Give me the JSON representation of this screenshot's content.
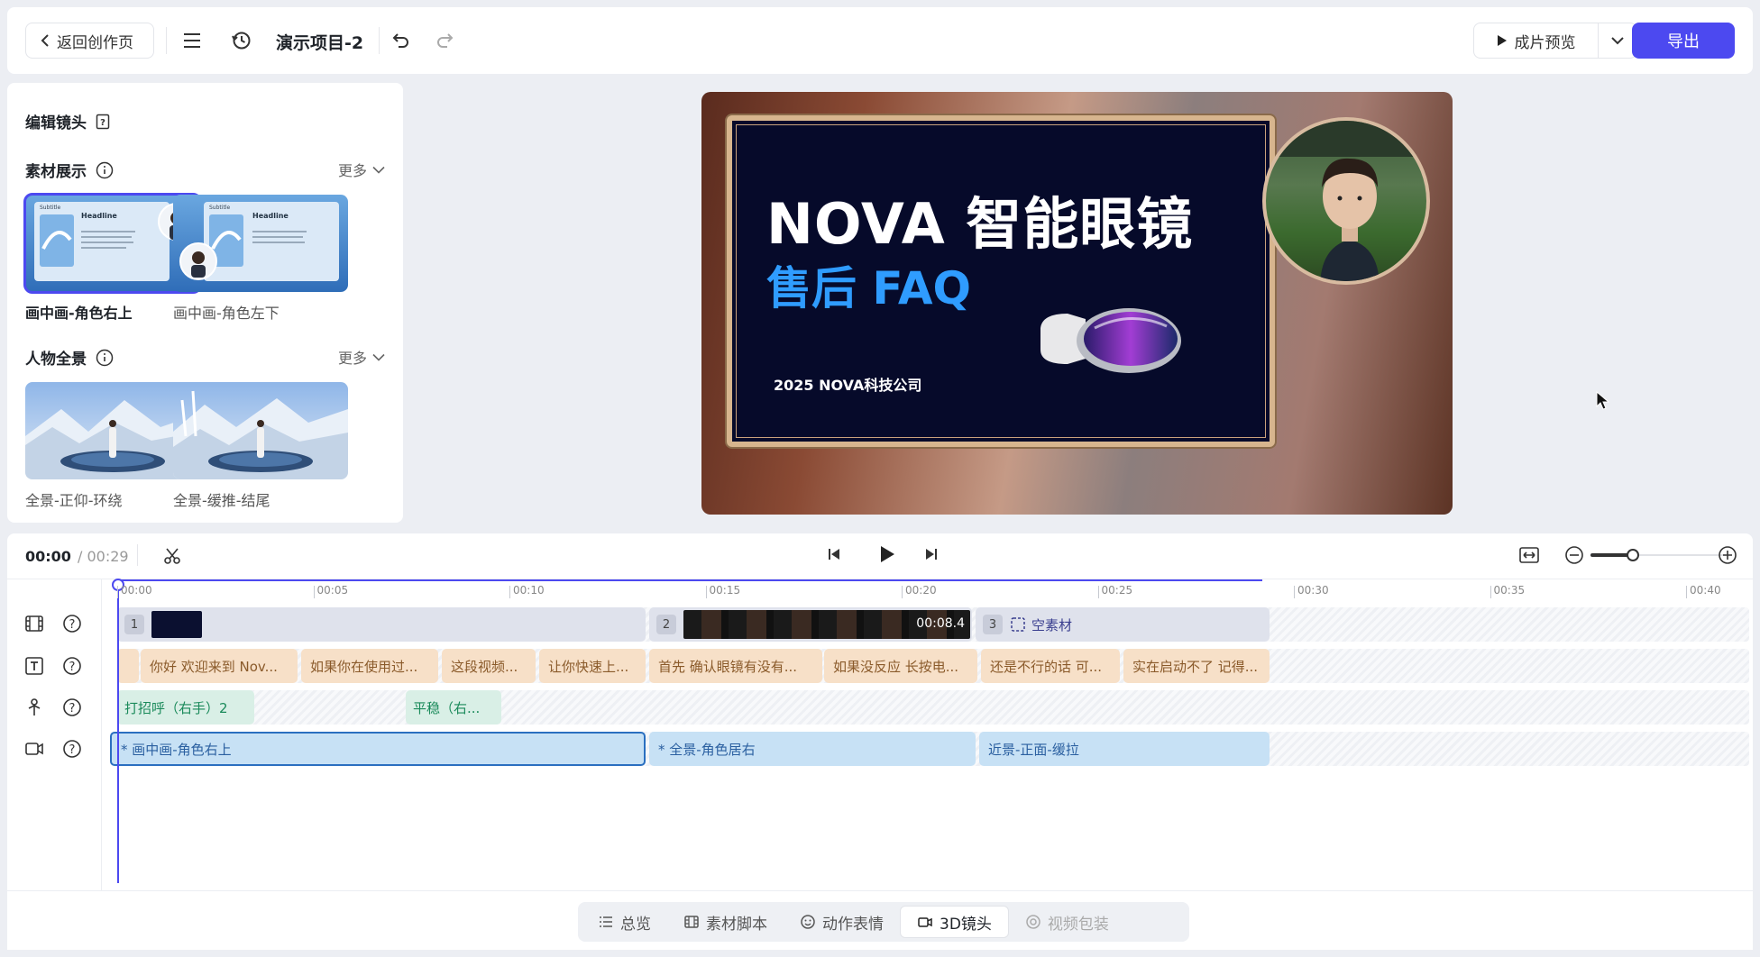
{
  "topbar": {
    "back_label": "返回创作页",
    "project_title": "演示项目-2",
    "preview_label": "成片预览",
    "export_label": "导出"
  },
  "panel": {
    "title": "编辑镜头",
    "sections": [
      {
        "title": "素材展示",
        "more": "更多",
        "items": [
          {
            "label": "画中画-角色右上",
            "selected": true
          },
          {
            "label": "画中画-角色左下",
            "selected": false
          }
        ]
      },
      {
        "title": "人物全景",
        "more": "更多",
        "items": [
          {
            "label": "全景-正仰-环绕",
            "selected": false
          },
          {
            "label": "全景-缓推-结尾",
            "selected": false
          }
        ]
      }
    ],
    "thumb_texts": {
      "subtitle": "Subtitle",
      "headline": "Headline"
    }
  },
  "preview": {
    "title_line1": "NOVA 智能眼镜",
    "title_line2": "售后 FAQ",
    "footer": "2025 NOVA科技公司"
  },
  "timeline": {
    "current_time": "00:00",
    "total_time": "/ 00:29",
    "ticks": [
      "00:00",
      "00:05",
      "00:10",
      "00:15",
      "00:20",
      "00:25",
      "00:30",
      "00:35",
      "00:40"
    ],
    "video_track": [
      {
        "num": "1",
        "label": ""
      },
      {
        "num": "2",
        "label": "00:08.4"
      },
      {
        "num": "3",
        "label": "空素材"
      }
    ],
    "text_track": [
      "你好 欢迎来到 Nov...",
      "如果你在使用过...",
      "这段视频...",
      "让你快速上...",
      "首先 确认眼镜有没有...",
      "如果没反应 长按电...",
      "还是不行的话 可...",
      "实在启动不了 记得..."
    ],
    "action_track": [
      "打招呼（右手）2",
      "平稳（右..."
    ],
    "camera_track": [
      "* 画中画-角色右上",
      "* 全景-角色居右",
      "近景-正面-缓拉"
    ]
  },
  "tabs": [
    "总览",
    "素材脚本",
    "动作表情",
    "3D镜头",
    "视频包装"
  ],
  "colors": {
    "accent": "#4c49f0",
    "text_seg": "#f7e0c8",
    "action_seg": "#d9efe6",
    "camera_seg": "#c7e1f5"
  }
}
